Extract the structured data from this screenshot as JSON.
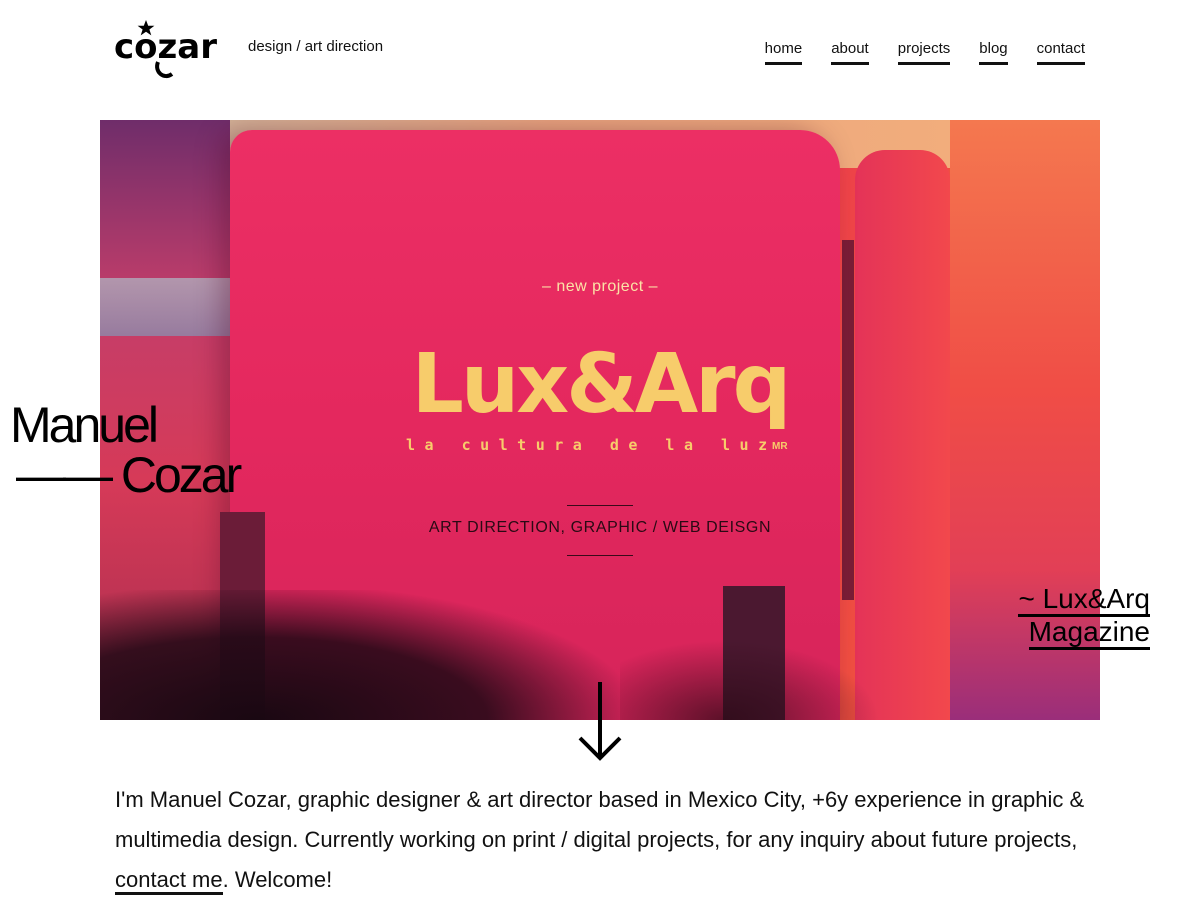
{
  "header": {
    "logo_text": "cozar",
    "logo_icon": "star-icon",
    "tagline": "design / art direction",
    "nav": [
      {
        "label": "home"
      },
      {
        "label": "about"
      },
      {
        "label": "projects"
      },
      {
        "label": "blog"
      },
      {
        "label": "contact"
      }
    ]
  },
  "hero": {
    "kicker": "– new project –",
    "brand": "Lux&Arq",
    "brand_sub": "la cultura de la luz",
    "brand_mark": "MR",
    "services": "ART DIRECTION, GRAPHIC / WEB DEISGN"
  },
  "overlay": {
    "name_line1": "Manuel",
    "name_line2": "—— Cozar"
  },
  "caption": {
    "line1": "~ Lux&Arq",
    "line2": "Magazine"
  },
  "scroll": {
    "icon": "arrow-down-icon"
  },
  "intro": {
    "text_before": "I'm Manuel Cozar, graphic designer & art director based in Mexico City, +6y experience in graphic & multimedia design. Currently working on print / digital projects, for any inquiry about future projects, ",
    "link": "contact me",
    "text_after": ". Welcome!"
  },
  "colors": {
    "text": "#111111",
    "hero_gold": "#f7cc6b",
    "hero_magenta": "#e1245f"
  }
}
